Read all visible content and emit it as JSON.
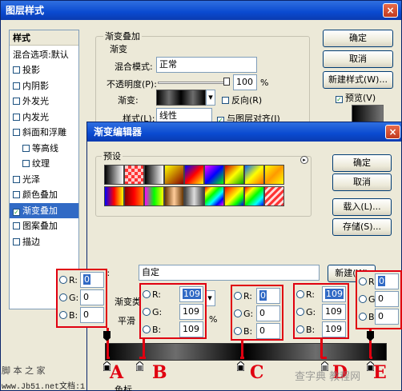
{
  "dialog": {
    "title": "图层样式",
    "close": "×",
    "styles_header": "样式",
    "blend_default": "混合选项:默认",
    "items": [
      {
        "label": "投影",
        "checked": false,
        "selected": false
      },
      {
        "label": "内阴影",
        "checked": false,
        "selected": false
      },
      {
        "label": "外发光",
        "checked": false,
        "selected": false
      },
      {
        "label": "内发光",
        "checked": false,
        "selected": false
      },
      {
        "label": "斜面和浮雕",
        "checked": false,
        "selected": false
      },
      {
        "label": "等高线",
        "checked": false,
        "selected": false
      },
      {
        "label": "纹理",
        "checked": false,
        "selected": false
      },
      {
        "label": "光泽",
        "checked": false,
        "selected": false
      },
      {
        "label": "颜色叠加",
        "checked": false,
        "selected": false
      },
      {
        "label": "渐变叠加",
        "checked": true,
        "selected": true
      },
      {
        "label": "图案叠加",
        "checked": false,
        "selected": false
      },
      {
        "label": "描边",
        "checked": false,
        "selected": false
      }
    ],
    "section_title": "渐变叠加",
    "subsection": "渐变",
    "blend_mode_label": "混合模式:",
    "blend_mode_value": "正常",
    "opacity_label": "不透明度(P):",
    "opacity_value": "100",
    "opacity_unit": "%",
    "gradient_label": "渐变:",
    "reverse_label": "反向(R)",
    "style_label": "样式(L):",
    "style_value": "线性",
    "align_label": "与图层对齐(I)",
    "ok": "确定",
    "cancel": "取消",
    "new_style": "新建样式(W)...",
    "preview": "预览(V)"
  },
  "editor": {
    "title": "渐变编辑器",
    "presets_label": "预设",
    "ok": "确定",
    "cancel": "取消",
    "load": "载入(L)...",
    "save": "存储(S)...",
    "name_label": "N):",
    "name_value": "自定",
    "new_button": "新建(W)",
    "type_label": "渐变类",
    "smooth_label": "平滑",
    "percent": "%",
    "color_label": "色标"
  },
  "annotations": {
    "boxes": [
      {
        "letter": "A",
        "r": "0",
        "g": "0",
        "b": "0"
      },
      {
        "letter": "B",
        "r": "109",
        "g": "109",
        "b": "109"
      },
      {
        "letter": "C",
        "r": "0",
        "g": "0",
        "b": "0"
      },
      {
        "letter": "D",
        "r": "109",
        "g": "109",
        "b": "109"
      },
      {
        "letter": "E",
        "r": "0",
        "g": "0",
        "b": "0"
      }
    ],
    "r_label": "R:",
    "g_label": "G:",
    "b_label": "B:"
  },
  "watermarks": {
    "left_title": "脚 本 之 家",
    "left_url": "www.Jb51.net",
    "left_tail": "文档:1",
    "right": "查字典 教程网"
  },
  "colors": {
    "red": "#e00010",
    "xp_blue": "#0a4ad0"
  }
}
